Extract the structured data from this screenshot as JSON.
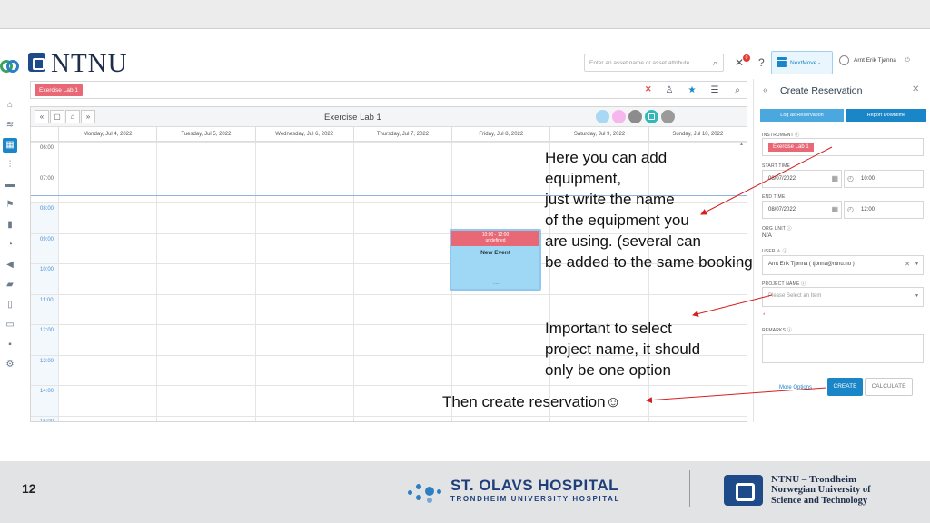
{
  "header": {
    "logo_text": "NTNU",
    "search_placeholder": "Enter an asset name or asset attribute",
    "notification_count": "0",
    "nextmove_label": "NextMove -...",
    "user_name": "Arnt Erik Tjønna"
  },
  "lab_bar": {
    "selected_lab": "Exercise Lab 1"
  },
  "calendar": {
    "title": "Exercise Lab 1",
    "nav": [
      "«",
      "▢",
      "⌂",
      "»"
    ],
    "days": [
      "Monday, Jul 4, 2022",
      "Tuesday, Jul 5, 2022",
      "Wednesday, Jul 6, 2022",
      "Thursday, Jul 7, 2022",
      "Friday, Jul 8, 2022",
      "Saturday, Jul 9, 2022",
      "Sunday, Jul 10, 2022"
    ],
    "hours": [
      "06:00",
      "07:00",
      "08:00",
      "09:00",
      "10:00",
      "11:00",
      "12:00",
      "13:00",
      "14:00",
      "15:00"
    ],
    "event": {
      "time": "10:00 - 12:00",
      "status": "undefined",
      "title": "New Event",
      "dots": "....."
    },
    "filter_dot_colors": [
      "#a8d8f3",
      "#f6b7ef",
      "#8c8c8c",
      "#34b7b8",
      "#9a9a9a"
    ]
  },
  "panel": {
    "title": "Create Reservation",
    "tab_log": "Log as Reservation",
    "tab_report": "Report Downtime",
    "instrument_label": "INSTRUMENT ⓘ",
    "instrument_value": "Exercise Lab 1",
    "start_label": "START TIME",
    "start_date": "08/07/2022",
    "start_time": "10:00",
    "end_label": "END TIME",
    "end_date": "08/07/2022",
    "end_time": "12:00",
    "org_label": "ORG UNIT ⓘ",
    "org_value": "N/A",
    "user_label": "USER",
    "user_value": "Arnt Erik Tjønna ( tjonna@ntnu.no )",
    "project_label": "PROJECT NAME ⓘ",
    "project_placeholder": "Please Select an Item",
    "required_mark": "*",
    "remarks_label": "REMARKS ⓘ",
    "more_options": "More Options",
    "create": "CREATE",
    "calculate": "CALCULATE"
  },
  "annotations": {
    "equipment": "Here you can add\nequipment,\njust write the name\nof the equipment you\nare using. (several can\nbe added to the same booking",
    "project": "Important to select\nproject name, it should\nonly be one option",
    "create": "Then create reservation☺"
  },
  "footer": {
    "page_number": "12",
    "hospital_name": "ST. OLAVS HOSPITAL",
    "hospital_sub": "TRONDHEIM UNIVERSITY HOSPITAL",
    "ntnu_line1": "NTNU – Trondheim",
    "ntnu_line2": "Norwegian University of",
    "ntnu_line3": "Science and Technology"
  },
  "colors": {
    "accent": "#1a86c8",
    "tag": "#e96876",
    "arrow": "#d62020"
  }
}
